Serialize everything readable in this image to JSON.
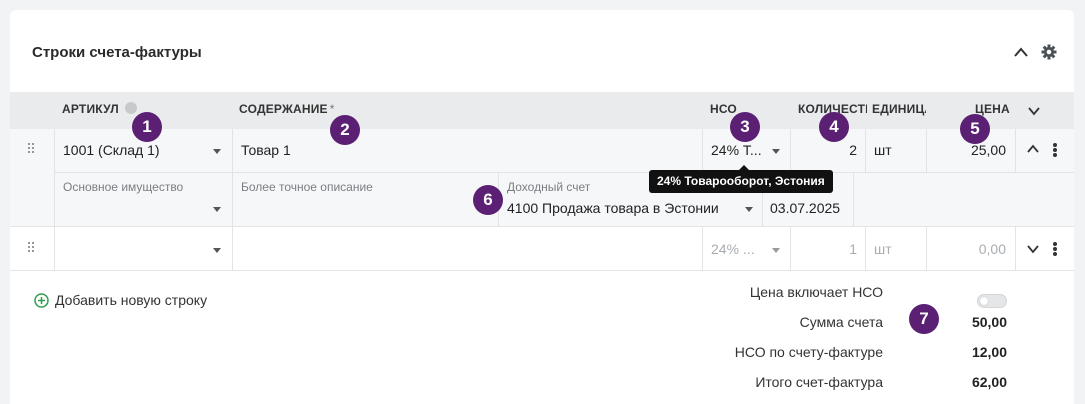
{
  "section": {
    "title": "Строки счета-фактуры"
  },
  "table": {
    "headers": {
      "article": "АРТИКУЛ",
      "content": "СОДЕРЖАНИЕ",
      "content_required": "*",
      "vat": "НСО",
      "quantity": "КОЛИЧЕСТВО",
      "unit": "ЕДИНИЦА",
      "price": "ЦЕНА"
    },
    "rows": [
      {
        "article": "1001 (Склад 1)",
        "content": "Товар 1",
        "vat": "24% Т...",
        "quantity": "2",
        "unit": "шт",
        "price": "25,00",
        "details": {
          "fixed_asset_label": "Основное имущество",
          "fixed_asset_value": "",
          "description_label": "Более точное описание",
          "description_value": "",
          "income_account_label": "Доходный счет",
          "income_account_value": "4100 Продажа товара в Эстонии",
          "date": "03.07.2025"
        }
      },
      {
        "article": "",
        "content": "",
        "vat": "24% ...",
        "quantity": "1",
        "unit": "шт",
        "price": "0,00"
      }
    ]
  },
  "tooltip": "24% Товарооборот, Эстония",
  "add_row_label": "Добавить новую строку",
  "summary": {
    "price_includes_vat_label": "Цена включает НСО",
    "price_includes_vat": false,
    "invoice_sum_label": "Сумма счета",
    "invoice_sum": "50,00",
    "vat_label": "НСО по счету-фактуре",
    "vat": "12,00",
    "total_label": "Итого счет-фактура",
    "total": "62,00"
  },
  "badges": [
    "1",
    "2",
    "3",
    "4",
    "5",
    "6",
    "7"
  ],
  "colors": {
    "badge": "#5b1f73",
    "add_icon": "#2e9e4f",
    "header_bg": "#e9ebed",
    "tooltip_bg": "#111111"
  }
}
